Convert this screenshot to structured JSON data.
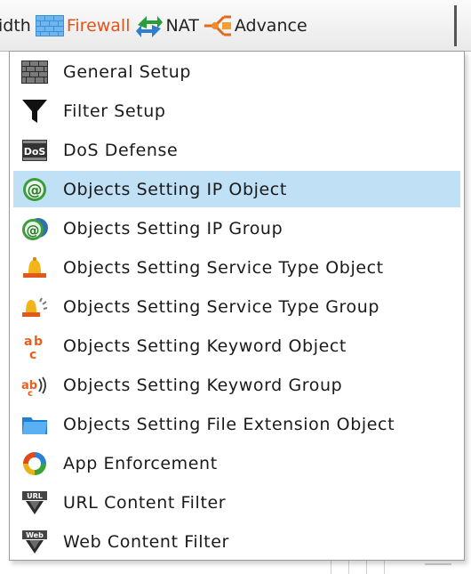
{
  "menubar": {
    "tabs": [
      {
        "label": "idth",
        "icon": "none"
      },
      {
        "label": "Firewall",
        "icon": "firewall-brick-icon",
        "active": true
      },
      {
        "label": "NAT",
        "icon": "nat-arrows-icon"
      },
      {
        "label": "Advance",
        "icon": "advance-network-icon"
      }
    ]
  },
  "dropdown": {
    "items": [
      {
        "label": "General Setup",
        "icon": "brick-wall-icon"
      },
      {
        "label": "Filter Setup",
        "icon": "funnel-icon"
      },
      {
        "label": "DoS Defense",
        "icon": "dos-icon"
      },
      {
        "label": "Objects Setting IP Object",
        "icon": "at-sign-icon",
        "highlighted": true
      },
      {
        "label": "Objects Setting IP Group",
        "icon": "at-sign-group-icon"
      },
      {
        "label": "Objects Setting Service Type Object",
        "icon": "bell-icon"
      },
      {
        "label": "Objects Setting Service Type Group",
        "icon": "bell-group-icon"
      },
      {
        "label": "Objects Setting Keyword Object",
        "icon": "abc-icon"
      },
      {
        "label": "Objects Setting Keyword Group",
        "icon": "abc-group-icon"
      },
      {
        "label": "Objects Setting File Extension Object",
        "icon": "folder-icon"
      },
      {
        "label": "App Enforcement",
        "icon": "app-ring-icon"
      },
      {
        "label": "URL Content Filter",
        "icon": "url-icon"
      },
      {
        "label": "Web Content Filter",
        "icon": "web-icon"
      }
    ]
  },
  "colors": {
    "active_tab": "#e2541a",
    "highlight": "#bfe0f5"
  }
}
